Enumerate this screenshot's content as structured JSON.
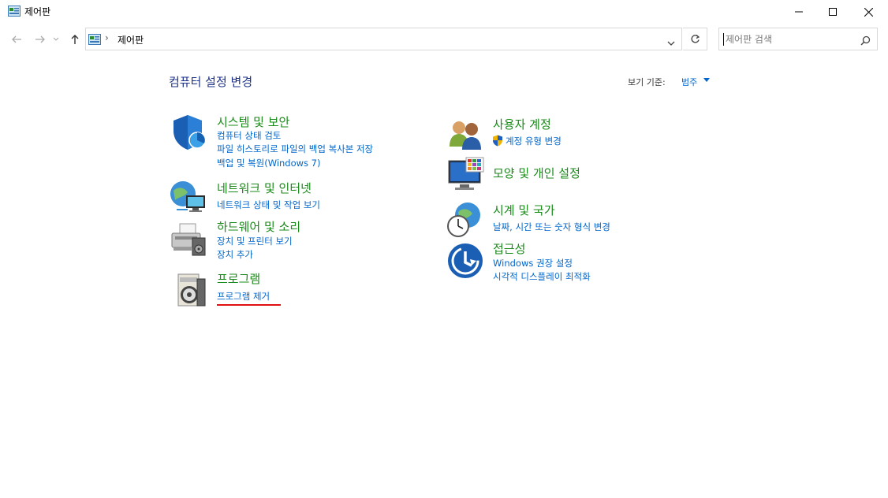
{
  "window": {
    "title": "제어판"
  },
  "address": {
    "crumb": "제어판",
    "separator": "›"
  },
  "search": {
    "placeholder": "제어판 검색"
  },
  "header": {
    "title": "컴퓨터 설정 변경",
    "view_by_label": "보기 기준:",
    "view_by_value": "범주"
  },
  "categories": {
    "system": {
      "title": "시스템 및 보안",
      "links": [
        "컴퓨터 상태 검토",
        "파일 히스토리로 파일의 백업 복사본 저장",
        "백업 및 복원(Windows 7)"
      ]
    },
    "network": {
      "title": "네트워크 및 인터넷",
      "links": [
        "네트워크 상태 및 작업 보기"
      ]
    },
    "hardware": {
      "title": "하드웨어 및 소리",
      "links": [
        "장치 및 프린터 보기",
        "장치 추가"
      ]
    },
    "programs": {
      "title": "프로그램",
      "links": [
        "프로그램 제거"
      ]
    },
    "users": {
      "title": "사용자 계정",
      "links": [
        "계정 유형 변경"
      ]
    },
    "appearance": {
      "title": "모양 및 개인 설정",
      "links": []
    },
    "clock": {
      "title": "시계 및 국가",
      "links": [
        "날짜, 시간 또는 숫자 형식 변경"
      ]
    },
    "ease": {
      "title": "접근성",
      "links": [
        "Windows 권장 설정",
        "시각적 디스플레이 최적화"
      ]
    }
  },
  "colors": {
    "category_title": "#1a8a1a",
    "link": "#0066cc",
    "heading": "#1e3287",
    "highlight_underline": "#e01010"
  }
}
